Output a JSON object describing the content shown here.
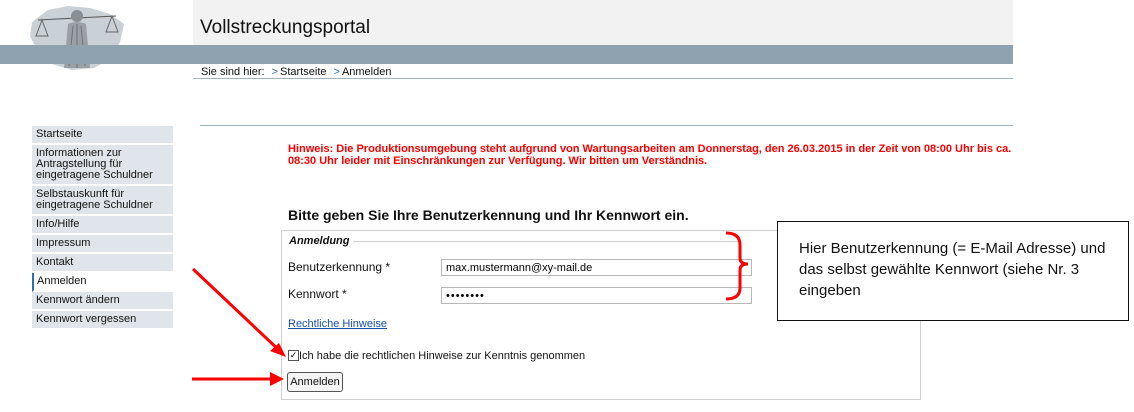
{
  "header": {
    "title": "Vollstreckungsportal"
  },
  "breadcrumb": {
    "prefix": "Sie sind hier:",
    "separator": ">",
    "items": [
      "Startseite",
      "Anmelden"
    ]
  },
  "sidebar": {
    "items": [
      {
        "label": "Startseite"
      },
      {
        "label": "Informationen zur Antragstellung für eingetragene Schuldner"
      },
      {
        "label": "Selbstauskunft für eingetragene Schuldner"
      },
      {
        "label": "Info/Hilfe"
      },
      {
        "label": "Impressum"
      },
      {
        "label": "Kontakt"
      },
      {
        "label": "Anmelden",
        "active": true
      },
      {
        "label": "Kennwort ändern"
      },
      {
        "label": "Kennwort vergessen"
      }
    ]
  },
  "notice": "Hinweis: Die Produktionsumgebung steht aufgrund von Wartungsarbeiten am Donnerstag, den 26.03.2015 in der Zeit von 08:00 Uhr bis ca. 08:30 Uhr leider mit Einschränkungen zur Verfügung. Wir bitten um Verständnis.",
  "login": {
    "heading": "Bitte geben Sie Ihre Benutzerkennung und Ihr Kennwort ein.",
    "legend": "Anmeldung",
    "username_label": "Benutzerkennung *",
    "username_value": "max.mustermann@xy-mail.de",
    "password_label": "Kennwort *",
    "password_value": "••••••••",
    "legal_link": "Rechtliche Hinweise",
    "checkbox_label": "Ich habe die rechtlichen Hinweise zur Kenntnis genommen",
    "checkbox_checked": true,
    "checkbox_mark": "✓",
    "submit_label": "Anmelden"
  },
  "annotation": {
    "text": "Hier Benutzerkennung (= E-Mail Adresse) und das selbst gewählte Kennwort (siehe Nr. 3 eingeben",
    "color": "#ff0000"
  },
  "colors": {
    "notice": "#ff0000",
    "nav_band": "#8ea2b0",
    "sidebar_bg": "#dfe5ea",
    "link": "#1a4ea8"
  }
}
